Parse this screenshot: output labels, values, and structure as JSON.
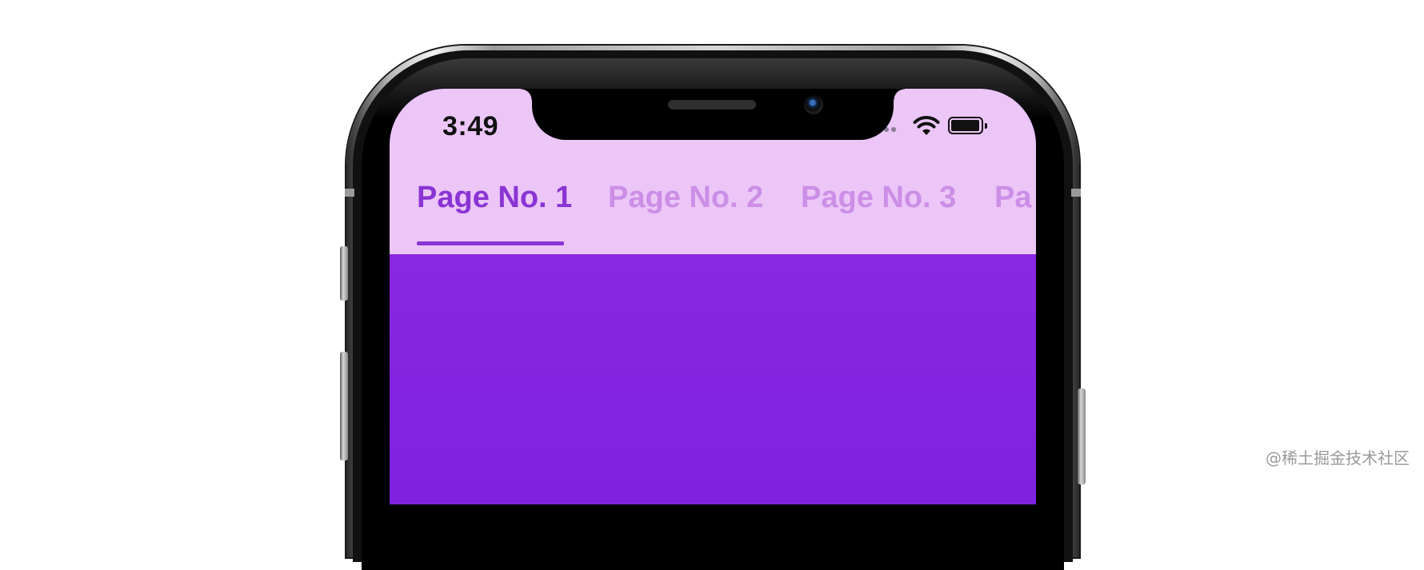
{
  "status_bar": {
    "time": "3:49",
    "icons": [
      "signal-icon",
      "wifi-icon",
      "battery-icon"
    ]
  },
  "tab_bar": {
    "tabs": [
      {
        "label": "Page No. 1",
        "active": true
      },
      {
        "label": "Page No. 2",
        "active": false
      },
      {
        "label": "Page No. 3",
        "active": false
      },
      {
        "label": "Pa",
        "active": false
      }
    ]
  },
  "watermark": "@稀土掘金技术社区",
  "colors": {
    "app_bar_bg": "#ebc6f7",
    "active_tab": "#8a34d4",
    "inactive_tab": "#cc8ee6",
    "content_bg": "#8227e0"
  }
}
